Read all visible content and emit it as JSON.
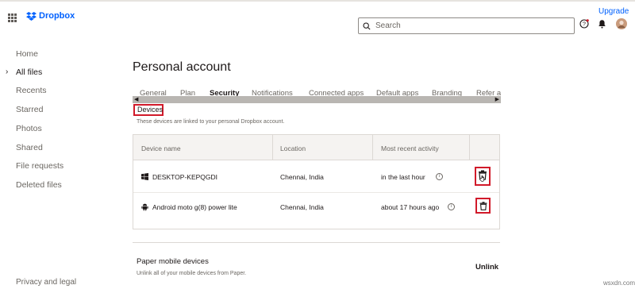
{
  "app": {
    "logo_text": "Dropbox",
    "upgrade_label": "Upgrade",
    "accent": "#0061fe",
    "highlight": "#d11a2a"
  },
  "search": {
    "placeholder": "Search"
  },
  "sidebar": {
    "items": [
      {
        "label": "Home",
        "active": false
      },
      {
        "label": "All files",
        "active": true
      },
      {
        "label": "Recents",
        "active": false
      },
      {
        "label": "Starred",
        "active": false
      },
      {
        "label": "Photos",
        "active": false
      },
      {
        "label": "Shared",
        "active": false
      },
      {
        "label": "File requests",
        "active": false
      },
      {
        "label": "Deleted files",
        "active": false
      }
    ],
    "footer": "Privacy and legal"
  },
  "main": {
    "title": "Personal account",
    "tabs": [
      {
        "label": "General"
      },
      {
        "label": "Plan"
      },
      {
        "label": "Security",
        "active": true
      },
      {
        "label": "Notifications"
      },
      {
        "label": "Connected apps"
      },
      {
        "label": "Default apps"
      },
      {
        "label": "Branding"
      },
      {
        "label": "Refer a"
      }
    ],
    "devices": {
      "heading": "Devices",
      "description": "These devices are linked to your personal Dropbox account.",
      "columns": [
        "Device name",
        "Location",
        "Most recent activity"
      ],
      "rows": [
        {
          "device": "DESKTOP-KEPQGDI",
          "icon": "windows-icon",
          "location": "Chennai, India",
          "activity": "in the last hour"
        },
        {
          "device": "Android moto g(8) power lite",
          "icon": "android-icon",
          "location": "Chennai, India",
          "activity": "about 17 hours ago"
        }
      ]
    },
    "paper": {
      "title": "Paper mobile devices",
      "description": "Unlink all of your mobile devices from Paper.",
      "unlink_label": "Unlink"
    }
  },
  "watermark": "wsxdn.com"
}
